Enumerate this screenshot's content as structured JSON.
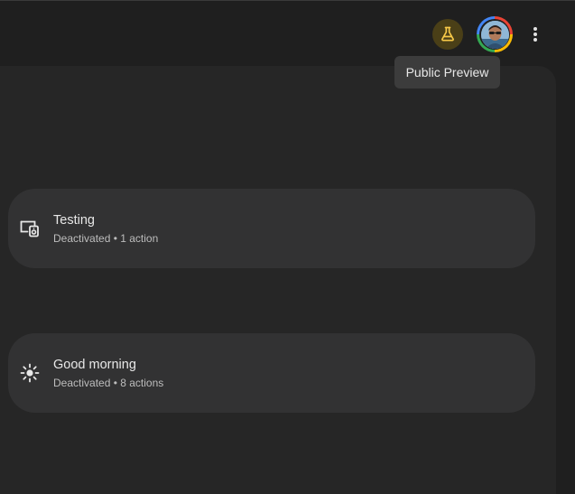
{
  "header": {
    "labs_icon": "flask-icon",
    "labs_color": "#f7c948",
    "avatar_icon": "user-avatar",
    "more_icon": "more-vert-icon",
    "tooltip": "Public Preview"
  },
  "routines": [
    {
      "icon": "speaker-display-icon",
      "title": "Testing",
      "subtitle": "Deactivated • 1 action"
    },
    {
      "icon": "sun-icon",
      "title": "Good morning",
      "subtitle": "Deactivated • 8 actions"
    }
  ],
  "colors": {
    "background": "#1f1f1f",
    "panel": "#262626",
    "card": "#323233",
    "tooltip": "#3c3c3c"
  }
}
